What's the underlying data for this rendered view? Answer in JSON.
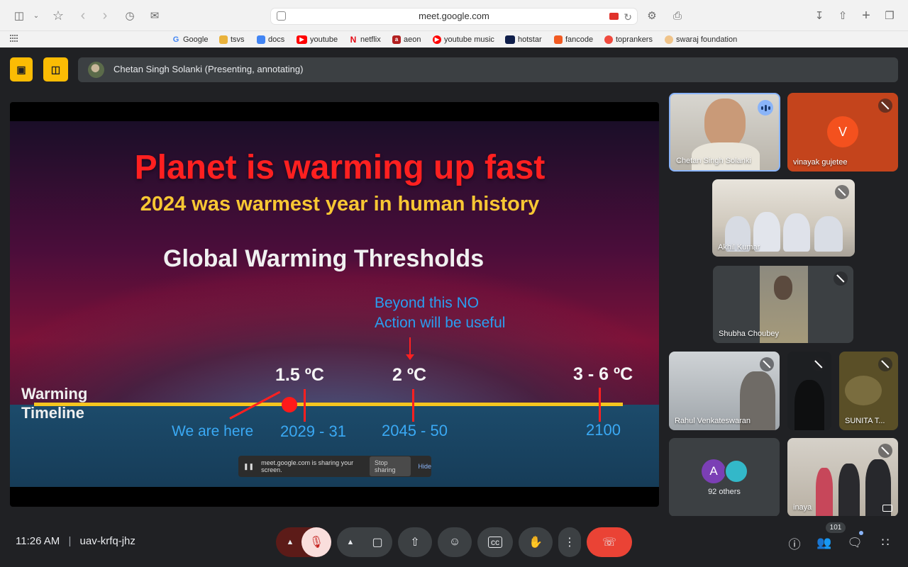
{
  "browser": {
    "url": "meet.google.com",
    "bookmarks": [
      "Google",
      "tsvs",
      "docs",
      "youtube",
      "netflix",
      "aeon",
      "youtube music",
      "hotstar",
      "fancode",
      "toprankers",
      "swaraj foundation"
    ]
  },
  "meet": {
    "presenter_status": "Chetan Singh Solanki (Presenting, annotating)",
    "meeting_time": "11:26 AM",
    "meeting_code": "uav-krfq-jhz",
    "participant_count": "101"
  },
  "slide": {
    "title": "Planet is warming up fast",
    "subtitle": "2024 was warmest year in human history",
    "heading": "Global Warming Thresholds",
    "beyond_line1": "Beyond this NO",
    "beyond_line2": "Action will be useful",
    "timeline_label_1": "Warming",
    "timeline_label_2": "Timeline",
    "temp_1": "1.5 ºC",
    "temp_2": "2 ºC",
    "temp_3": "3 - 6 ºC",
    "year_1": "2029 - 31",
    "year_2": "2045 - 50",
    "year_3": "2100",
    "we_are_here": "We are here"
  },
  "share_notice": {
    "text": "meet.google.com is sharing your screen.",
    "stop": "Stop sharing",
    "hide": "Hide"
  },
  "tiles": {
    "t1": {
      "name": "Chetan Singh Solanki"
    },
    "t2": {
      "name": "vinayak gujetee",
      "initial": "V"
    },
    "t3": {
      "name": "Akhil Kumar"
    },
    "t4": {
      "name": "Shubha Choubey"
    },
    "t5": {
      "name": "Rahul Venkateswaran"
    },
    "t6": {
      "name": ""
    },
    "t7": {
      "name": "SUNITA T..."
    },
    "t8": {
      "others": "92 others",
      "avatar_a": "A"
    },
    "t9": {
      "name": "inaya"
    }
  },
  "colors": {
    "accent_yellow": "#fbbc04",
    "end_call_red": "#ea4335",
    "slide_title_red": "#ff2020",
    "timeline_yellow": "#f5c51f"
  }
}
